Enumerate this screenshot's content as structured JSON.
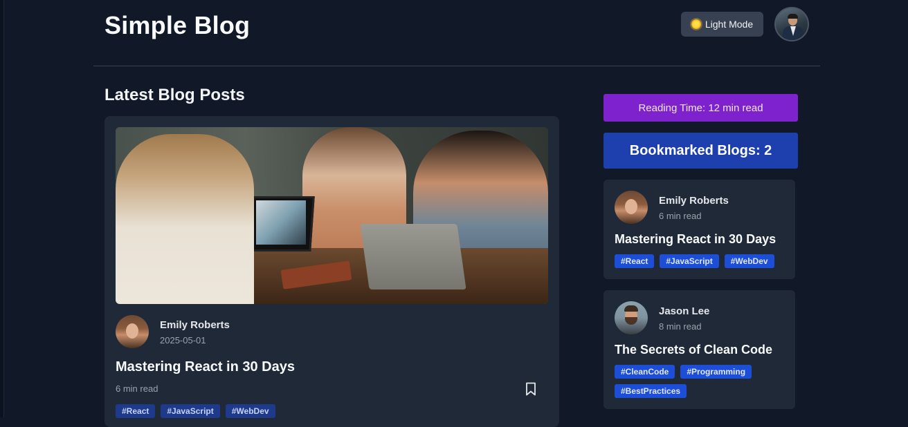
{
  "header": {
    "site_title": "Simple Blog",
    "mode_toggle_label": "Light Mode"
  },
  "main": {
    "section_title": "Latest Blog Posts",
    "post": {
      "author": "Emily Roberts",
      "date": "2025-05-01",
      "title": "Mastering React in 30 Days",
      "read_time": "6 min read",
      "tags": [
        "#React",
        "#JavaScript",
        "#WebDev"
      ]
    }
  },
  "sidebar": {
    "reading_time": "Reading Time: 12 min read",
    "bookmarked": "Bookmarked Blogs: 2",
    "bookmarks": [
      {
        "author": "Emily Roberts",
        "read_time": "6 min read",
        "title": "Mastering React in 30 Days",
        "tags": [
          "#React",
          "#JavaScript",
          "#WebDev"
        ]
      },
      {
        "author": "Jason Lee",
        "read_time": "8 min read",
        "title": "The Secrets of Clean Code",
        "tags": [
          "#CleanCode",
          "#Programming",
          "#BestPractices"
        ]
      }
    ]
  },
  "colors": {
    "background": "#111827",
    "card": "#1f2937",
    "reading_time_bg": "#7e22ce",
    "bookmarked_bg": "#1e40af",
    "tag_bg": "#1d4ed8"
  },
  "icons": {
    "mode": "sun-icon",
    "bookmark": "bookmark-icon"
  }
}
